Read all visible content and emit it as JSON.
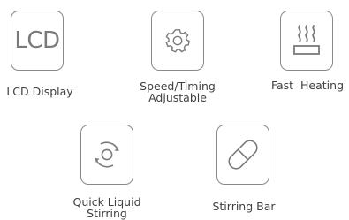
{
  "features": [
    {
      "name": "lcd-display",
      "tile_text": "LCD",
      "label": "LCD Display",
      "icon": "lcd-text-icon"
    },
    {
      "name": "speed-timing",
      "label_line1": "Speed/Timing",
      "label_line2": "Adjustable",
      "icon": "gear-icon"
    },
    {
      "name": "fast-heating",
      "label": "Fast  Heating",
      "icon": "heat-waves-icon"
    },
    {
      "name": "quick-liquid-stirring",
      "label_line1": "Quick Liquid",
      "label_line2": "Stirring",
      "icon": "rotation-icon"
    },
    {
      "name": "stirring-bar",
      "label": "Stirring Bar",
      "icon": "capsule-icon"
    }
  ],
  "colors": {
    "icon_stroke": "#7a7a7a",
    "label_text": "#3f3f3f"
  }
}
